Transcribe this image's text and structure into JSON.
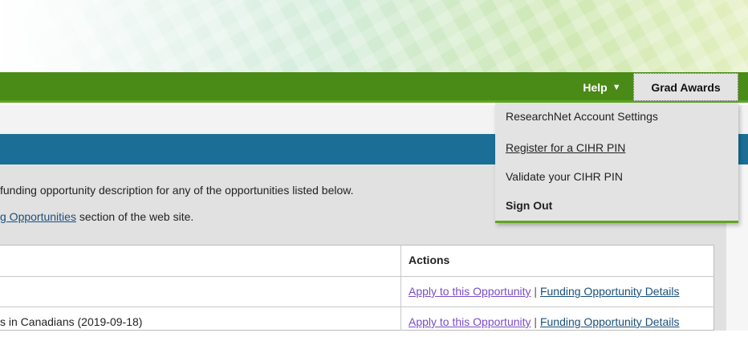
{
  "header": {
    "help_label": "Help",
    "grad_awards_label": "Grad Awards",
    "chevron_icon": "chevron-down-icon"
  },
  "dropdown": {
    "items": [
      {
        "label": "ResearchNet Account Settings"
      },
      {
        "label": "Register for a CIHR PIN"
      },
      {
        "label": "Validate your CIHR PIN"
      },
      {
        "label": "Sign Out"
      }
    ]
  },
  "intro": {
    "line1": "funding opportunity description for any of the opportunities listed below.",
    "line2_link": "g Opportunities",
    "line2_rest": " section of the web site."
  },
  "table": {
    "actions_header": "Actions",
    "rows": [
      {
        "text": "",
        "apply": "Apply to this Opportunity",
        "sep": "|",
        "details": "Funding Opportunity Details"
      },
      {
        "text": "s in Canadians (2019-09-18)",
        "apply": "Apply to this Opportunity",
        "sep": "|",
        "details": "Funding Opportunity Details"
      }
    ]
  },
  "colors": {
    "nav_green": "#4a8a17",
    "accent_green": "#5fa523",
    "section_blue": "#1b6f96",
    "link_visited": "#7a4cc7",
    "link": "#1a4f7a"
  }
}
